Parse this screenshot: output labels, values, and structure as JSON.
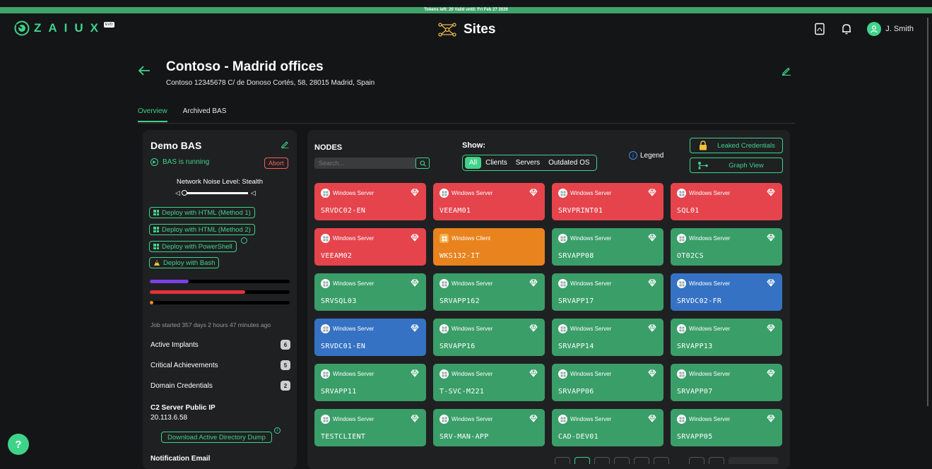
{
  "banner": {
    "text": "Tokens left: 20   Valid until: Fri Feb 27 2026"
  },
  "app": {
    "logo_text": "ZAIUX",
    "logo_badge": "EVO",
    "page_title": "Sites"
  },
  "user": {
    "name": "J. Smith"
  },
  "site": {
    "title": "Contoso - Madrid offices",
    "subtitle": "Contoso  12345678  C/ de Donoso Cortés, 58, 28015 Madrid, Spain"
  },
  "tabs": [
    {
      "label": "Overview"
    },
    {
      "label": "Archived BAS"
    }
  ],
  "bas": {
    "title": "Demo BAS",
    "status": "BAS is running",
    "abort_label": "Abort",
    "noise_label": "Network Noise Level: Stealth",
    "noise_level": 0,
    "deploy": [
      {
        "label": "Deploy with HTML (Method 1)",
        "icon": "windows-icon"
      },
      {
        "label": "Deploy with HTML (Method 2)",
        "icon": "windows-icon"
      },
      {
        "label": "Deploy with PowerShell",
        "icon": "windows-icon"
      },
      {
        "label": "Deploy with Bash",
        "icon": "linux-icon"
      }
    ],
    "progress": [
      {
        "color": "#7b3fe4",
        "fraction": 0.28
      },
      {
        "color": "#e5303b",
        "fraction": 0.68
      },
      {
        "color": "#f08a1c",
        "fraction": 0.02
      }
    ],
    "job_started": "Job started 357 days 2 hours 47 minutes ago",
    "metrics": [
      {
        "label": "Active Implants",
        "count": "6"
      },
      {
        "label": "Critical Achievements",
        "count": "5"
      },
      {
        "label": "Domain Credentials",
        "count": "2"
      }
    ],
    "c2_label": "C2 Server Public IP",
    "c2_ip": "20.113.6.58",
    "download_label": "Download Active Directory Dump",
    "notification_label": "Notification Email"
  },
  "nodes": {
    "title": "NODES",
    "search_placeholder": "Search...",
    "show_label": "Show:",
    "filters": [
      {
        "label": "All",
        "active": true
      },
      {
        "label": "Clients"
      },
      {
        "label": "Servers"
      },
      {
        "label": "Outdated OS"
      }
    ],
    "legend_label": "Legend",
    "leaked_label": "Leaked Credentials",
    "graph_label": "Graph View",
    "colors": {
      "red": "#e5444c",
      "orange": "#e8831e",
      "green": "#3a9e68",
      "blue": "#3572c4"
    },
    "items": [
      {
        "os": "Windows Server",
        "name": "SRVDC02-EN",
        "color": "red"
      },
      {
        "os": "Windows Server",
        "name": "VEEAM01",
        "color": "red"
      },
      {
        "os": "Windows Server",
        "name": "SRVPRINT01",
        "color": "red"
      },
      {
        "os": "Windows Server",
        "name": "SQL01",
        "color": "red"
      },
      {
        "os": "Windows Server",
        "name": "VEEAM02",
        "color": "red"
      },
      {
        "os": "Windows Client",
        "name": "WKS132-IT",
        "color": "orange"
      },
      {
        "os": "Windows Server",
        "name": "SRVAPP08",
        "color": "green"
      },
      {
        "os": "Windows Server",
        "name": "OT02CS",
        "color": "green"
      },
      {
        "os": "Windows Server",
        "name": "SRVSQL03",
        "color": "green"
      },
      {
        "os": "Windows Server",
        "name": "SRVAPP162",
        "color": "green"
      },
      {
        "os": "Windows Server",
        "name": "SRVAPP17",
        "color": "green"
      },
      {
        "os": "Windows Server",
        "name": "SRVDC02-FR",
        "color": "blue"
      },
      {
        "os": "Windows Server",
        "name": "SRVDC01-EN",
        "color": "blue"
      },
      {
        "os": "Windows Server",
        "name": "SRVAPP16",
        "color": "green"
      },
      {
        "os": "Windows Server",
        "name": "SRVAPP14",
        "color": "green"
      },
      {
        "os": "Windows Server",
        "name": "SRVAPP13",
        "color": "green"
      },
      {
        "os": "Windows Server",
        "name": "SRVAPP11",
        "color": "green"
      },
      {
        "os": "Windows Server",
        "name": "T-SVC-M221",
        "color": "green"
      },
      {
        "os": "Windows Server",
        "name": "SRVAPP06",
        "color": "green"
      },
      {
        "os": "Windows Server",
        "name": "SRVAPP07",
        "color": "green"
      },
      {
        "os": "Windows Server",
        "name": "TESTCLIENT",
        "color": "green"
      },
      {
        "os": "Windows Server",
        "name": "SRV-MAN-APP",
        "color": "green"
      },
      {
        "os": "Windows Server",
        "name": "CAD-DEV01",
        "color": "green"
      },
      {
        "os": "Windows Server",
        "name": "SRVAPP05",
        "color": "green"
      }
    ]
  },
  "help_label": "?"
}
